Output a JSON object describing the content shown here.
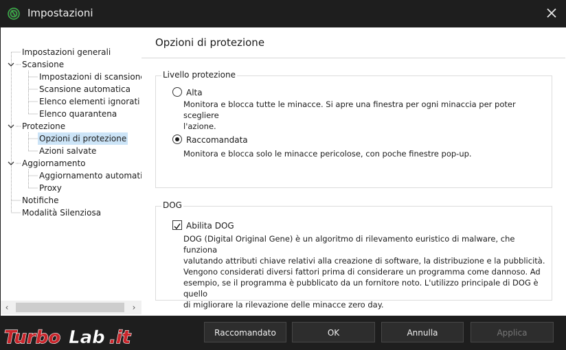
{
  "window": {
    "title": "Impostazioni",
    "app_icon": "app-logo-icon",
    "close_icon": "close-icon"
  },
  "sidebar": {
    "items": [
      {
        "label": "Impostazioni generali"
      },
      {
        "label": "Scansione"
      },
      {
        "label": "Impostazioni di scansione"
      },
      {
        "label": "Scansione automatica"
      },
      {
        "label": "Elenco elementi ignorati"
      },
      {
        "label": "Elenco quarantena"
      },
      {
        "label": "Protezione"
      },
      {
        "label": "Opzioni di protezione"
      },
      {
        "label": "Azioni salvate"
      },
      {
        "label": "Aggiornamento"
      },
      {
        "label": "Aggiornamento automatico"
      },
      {
        "label": "Proxy"
      },
      {
        "label": "Notifiche"
      },
      {
        "label": "Modalità Silenziosa"
      }
    ],
    "selected": "Opzioni di protezione",
    "scroll_left_glyph": "‹",
    "scroll_right_glyph": "›"
  },
  "main": {
    "title": "Opzioni di protezione",
    "protection_level": {
      "title": "Livello protezione",
      "options": [
        {
          "label": "Alta",
          "selected": false,
          "desc_lines": [
            "Monitora e blocca tutte le minacce. Si apre una finestra per ogni minaccia per poter scegliere",
            "l'azione."
          ]
        },
        {
          "label": "Raccomandata",
          "selected": true,
          "desc_lines": [
            "Monitora e blocca solo le minacce pericolose, con poche finestre pop-up."
          ]
        }
      ]
    },
    "dog": {
      "title": "DOG",
      "checkbox_label": "Abilita DOG",
      "checked": true,
      "desc_lines": [
        "DOG (Digital Original Gene) è un algoritmo di rilevamento euristico di malware, che funziona",
        "valutando attributi chiave relativi alla creazione di software, la distribuzione e la pubblicità.",
        "Vengono considerati diversi fattori prima di considerare un programma come dannoso. Ad",
        "esempio, se il programma è pubblicato da un fornitore noto. L'utilizzo principale di DOG è quello",
        "di migliorare la rilevazione delle minacce zero day."
      ]
    }
  },
  "footer": {
    "buttons": [
      {
        "label": "Raccomandato",
        "enabled": true
      },
      {
        "label": "OK",
        "enabled": true
      },
      {
        "label": "Annulla",
        "enabled": true
      },
      {
        "label": "Applica",
        "enabled": false
      }
    ]
  },
  "watermark": {
    "text_part1": "Turbo",
    "text_part2": "Lab",
    "text_part3": ".it"
  },
  "colors": {
    "titlebar": "#1e1e1e",
    "selection": "#cce4f7",
    "logo_green": "#3bb54a",
    "watermark_red": "#c9252b"
  }
}
